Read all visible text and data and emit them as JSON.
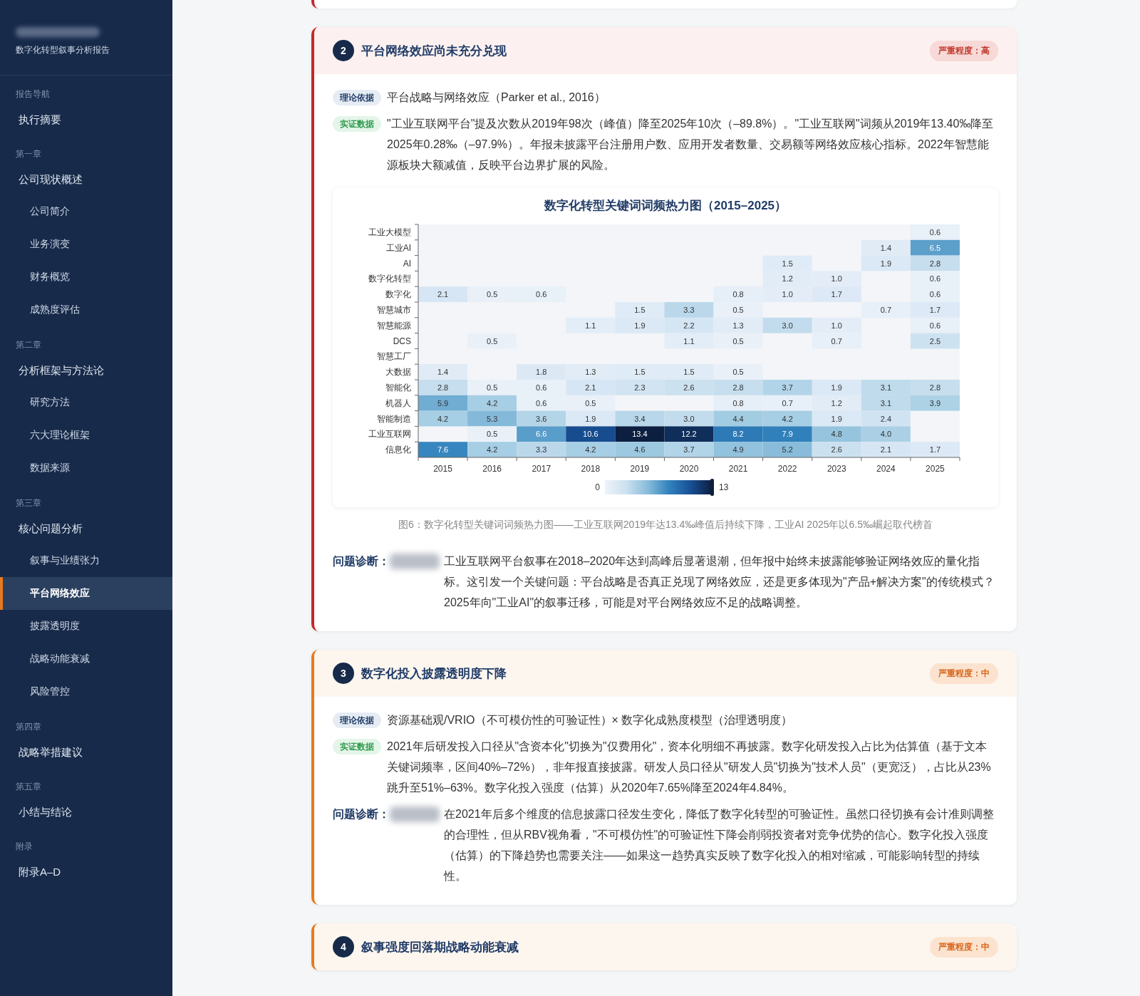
{
  "sidebar": {
    "brand": {
      "subtitle": "数字化转型叙事分析报告"
    },
    "sections": [
      {
        "heading": "报告导航",
        "items": [
          {
            "label": "执行摘要",
            "kind": "main",
            "selected": false
          }
        ]
      },
      {
        "heading": "第一章",
        "items": [
          {
            "label": "公司现状概述",
            "kind": "main",
            "selected": false
          },
          {
            "label": "公司简介",
            "kind": "sub",
            "selected": false
          },
          {
            "label": "业务演变",
            "kind": "sub",
            "selected": false
          },
          {
            "label": "财务概览",
            "kind": "sub",
            "selected": false
          },
          {
            "label": "成熟度评估",
            "kind": "sub",
            "selected": false
          }
        ]
      },
      {
        "heading": "第二章",
        "items": [
          {
            "label": "分析框架与方法论",
            "kind": "main",
            "selected": false
          },
          {
            "label": "研究方法",
            "kind": "sub",
            "selected": false
          },
          {
            "label": "六大理论框架",
            "kind": "sub",
            "selected": false
          },
          {
            "label": "数据来源",
            "kind": "sub",
            "selected": false
          }
        ]
      },
      {
        "heading": "第三章",
        "items": [
          {
            "label": "核心问题分析",
            "kind": "main",
            "selected": false
          },
          {
            "label": "叙事与业绩张力",
            "kind": "sub",
            "selected": false
          },
          {
            "label": "平台网络效应",
            "kind": "sub",
            "selected": true
          },
          {
            "label": "披露透明度",
            "kind": "sub",
            "selected": false
          },
          {
            "label": "战略动能衰减",
            "kind": "sub",
            "selected": false
          },
          {
            "label": "风险管控",
            "kind": "sub",
            "selected": false
          }
        ]
      },
      {
        "heading": "第四章",
        "items": [
          {
            "label": "战略举措建议",
            "kind": "main",
            "selected": false
          }
        ]
      },
      {
        "heading": "第五章",
        "items": [
          {
            "label": "小结与结论",
            "kind": "main",
            "selected": false
          }
        ]
      },
      {
        "heading": "附录",
        "items": [
          {
            "label": "附录A–D",
            "kind": "main",
            "selected": false
          }
        ]
      }
    ]
  },
  "issues": [
    {
      "number": "2",
      "title": "平台网络效应尚未充分兑现",
      "kind": "high",
      "severity_label": "严重程度：高",
      "blocks": [
        {
          "kind": "theory",
          "tag": "理论依据",
          "text": "平台战略与网络效应（Parker et al., 2016）"
        },
        {
          "kind": "evidence",
          "tag": "实证数据",
          "text": "\"工业互联网平台\"提及次数从2019年98次（峰值）降至2025年10次（–89.8%）。\"工业互联网\"词频从2019年13.40‰降至2025年0.28‰（–97.9%）。年报未披露平台注册用户数、应用开发者数量、交易额等网络效应核心指标。2022年智慧能源板块大额减值，反映平台边界扩展的风险。"
        }
      ],
      "figure": {
        "heatmap": {
          "title": "数字化转型关键词词频热力图（2015–2025）",
          "rows": [
            {
              "label": "工业大模型",
              "cells": [
                null,
                null,
                null,
                null,
                null,
                null,
                null,
                null,
                null,
                null,
                "0.6"
              ]
            },
            {
              "label": "工业AI",
              "cells": [
                null,
                null,
                null,
                null,
                null,
                null,
                null,
                null,
                null,
                "1.4",
                "6.5"
              ]
            },
            {
              "label": "AI",
              "cells": [
                null,
                null,
                null,
                null,
                null,
                null,
                null,
                "1.5",
                null,
                "1.9",
                "2.8"
              ]
            },
            {
              "label": "数字化转型",
              "cells": [
                null,
                null,
                null,
                null,
                null,
                null,
                null,
                "1.2",
                "1.0",
                null,
                "0.6"
              ]
            },
            {
              "label": "数字化",
              "cells": [
                "2.1",
                "0.5",
                "0.6",
                null,
                null,
                null,
                "0.8",
                "1.0",
                "1.7",
                null,
                "0.6"
              ]
            },
            {
              "label": "智慧城市",
              "cells": [
                null,
                null,
                null,
                null,
                "1.5",
                "3.3",
                "0.5",
                null,
                null,
                "0.7",
                "1.7"
              ]
            },
            {
              "label": "智慧能源",
              "cells": [
                null,
                null,
                null,
                "1.1",
                "1.9",
                "2.2",
                "1.3",
                "3.0",
                "1.0",
                null,
                "0.6"
              ]
            },
            {
              "label": "DCS",
              "cells": [
                null,
                "0.5",
                null,
                null,
                null,
                "1.1",
                "0.5",
                null,
                "0.7",
                null,
                "2.5"
              ]
            },
            {
              "label": "智慧工厂",
              "cells": [
                null,
                null,
                null,
                null,
                null,
                null,
                null,
                null,
                null,
                null,
                null
              ]
            },
            {
              "label": "大数据",
              "cells": [
                "1.4",
                null,
                "1.8",
                "1.3",
                "1.5",
                "1.5",
                "0.5",
                null,
                null,
                null,
                null
              ]
            },
            {
              "label": "智能化",
              "cells": [
                "2.8",
                "0.5",
                "0.6",
                "2.1",
                "2.3",
                "2.6",
                "2.8",
                "3.7",
                "1.9",
                "3.1",
                "2.8"
              ]
            },
            {
              "label": "机器人",
              "cells": [
                "5.9",
                "4.2",
                "0.6",
                "0.5",
                null,
                null,
                "0.8",
                "0.7",
                "1.2",
                "3.1",
                "3.9"
              ]
            },
            {
              "label": "智能制造",
              "cells": [
                "4.2",
                "5.3",
                "3.6",
                "1.9",
                "3.4",
                "3.0",
                "4.4",
                "4.2",
                "1.9",
                "2.4",
                null
              ]
            },
            {
              "label": "工业互联网",
              "cells": [
                null,
                "0.5",
                "6.6",
                "10.6",
                "13.4",
                "12.2",
                "8.2",
                "7.9",
                "4.8",
                "4.0",
                null
              ]
            },
            {
              "label": "信息化",
              "cells": [
                "7.6",
                "4.2",
                "3.3",
                "4.2",
                "4.6",
                "3.7",
                "4.9",
                "5.2",
                "2.6",
                "2.1",
                "1.7"
              ]
            }
          ],
          "year_axis": [
            "2015",
            "2016",
            "2017",
            "2018",
            "2019",
            "2020",
            "2021",
            "2022",
            "2023",
            "2024",
            "2025"
          ]
        },
        "scale": {
          "min_label": "0",
          "max_label": "13"
        },
        "caption": "图6：数字化转型关键词词频热力图——工业互联网2019年达13.4‰峰值后持续下降，工业AI 2025年以6.5‰崛起取代榜首"
      },
      "diagnosis": {
        "label": "问题诊断：",
        "text": "工业互联网平台叙事在2018–2020年达到高峰后显著退潮，但年报中始终未披露能够验证网络效应的量化指标。这引发一个关键问题：平台战略是否真正兑现了网络效应，还是更多体现为\"产品+解决方案\"的传统模式？2025年向\"工业AI\"的叙事迁移，可能是对平台网络效应不足的战略调整。"
      }
    },
    {
      "number": "3",
      "title": "数字化投入披露透明度下降",
      "kind": "medium",
      "severity_label": "严重程度：中",
      "blocks": [
        {
          "kind": "theory",
          "tag": "理论依据",
          "text": "资源基础观/VRIO（不可模仿性的可验证性）× 数字化成熟度模型（治理透明度）"
        },
        {
          "kind": "evidence",
          "tag": "实证数据",
          "text": "2021年后研发投入口径从\"含资本化\"切换为\"仅费用化\"，资本化明细不再披露。数字化研发投入占比为估算值（基于文本关键词频率，区间40%–72%），非年报直接披露。研发人员口径从\"研发人员\"切换为\"技术人员\"（更宽泛），占比从23%跳升至51%–63%。数字化投入强度（估算）从2020年7.65%降至2024年4.84%。"
        }
      ],
      "diagnosis": {
        "label": "问题诊断：",
        "text": "在2021年后多个维度的信息披露口径发生变化，降低了数字化转型的可验证性。虽然口径切换有会计准则调整的合理性，但从RBV视角看，\"不可模仿性\"的可验证性下降会削弱投资者对竞争优势的信心。数字化投入强度（估算）的下降趋势也需要关注——如果这一趋势真实反映了数字化投入的相对缩减，可能影响转型的持续性。"
      }
    },
    {
      "number": "4",
      "title": "叙事强度回落期战略动能衰减",
      "kind": "medium",
      "severity_label": "严重程度：中"
    }
  ]
}
